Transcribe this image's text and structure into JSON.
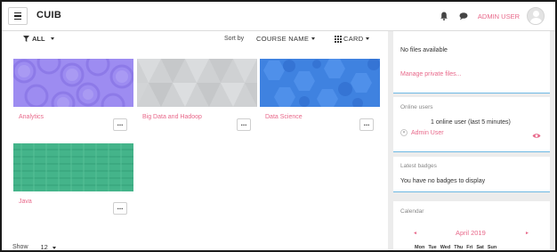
{
  "navbar": {
    "site_name": "CUIB",
    "user_name": "ADMIN USER",
    "icons": [
      "menu-icon",
      "bell-icon",
      "chat-icon",
      "user-avatar-icon"
    ]
  },
  "toolbar": {
    "filter_label": "ALL",
    "sort_by_label": "Sort by",
    "sort_value": "COURSE NAME",
    "view_value": "CARD"
  },
  "courses": [
    {
      "title": "Analytics",
      "menu": "..."
    },
    {
      "title": "Big Data and Hadoop",
      "menu": "..."
    },
    {
      "title": "Data Science",
      "menu": "..."
    },
    {
      "title": "Java",
      "menu": "..."
    }
  ],
  "pagination": {
    "show_label": "Show",
    "show_value": "12"
  },
  "private_files": {
    "status": "No files available",
    "manage_link": "Manage private files..."
  },
  "online_users": {
    "title": "Online users",
    "summary": "1 online user (last 5 minutes)",
    "users": [
      "Admin User"
    ]
  },
  "latest_badges": {
    "title": "Latest badges",
    "message": "You have no badges to display"
  },
  "calendar": {
    "title": "Calendar",
    "month": "April 2019",
    "prev": "◄",
    "next": "►",
    "weekdays": [
      "Mon",
      "Tue",
      "Wed",
      "Thu",
      "Fri",
      "Sat",
      "Sun"
    ]
  },
  "colors": {
    "accent": "#e8688a",
    "block_border": "#6db8e3",
    "analytics_bg": "#9f8ef0",
    "bigdata_bg": "#cfd1d3",
    "datascience_bg": "#3f82e0",
    "java_bg": "#44b48a"
  }
}
